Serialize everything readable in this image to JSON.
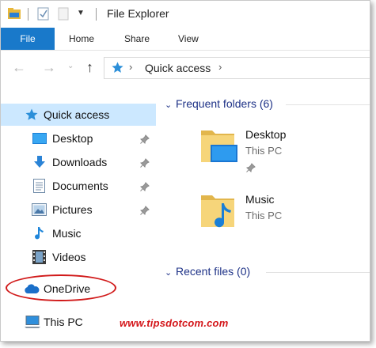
{
  "window": {
    "title": "File Explorer"
  },
  "ribbon": {
    "tabs": [
      "File",
      "Home",
      "Share",
      "View"
    ]
  },
  "address": {
    "location": "Quick access"
  },
  "nav_pane": {
    "items": [
      {
        "label": "Quick access",
        "icon": "star-icon",
        "selected": true
      },
      {
        "label": "Desktop",
        "icon": "desktop-icon",
        "pinned": true
      },
      {
        "label": "Downloads",
        "icon": "download-arrow-icon",
        "pinned": true
      },
      {
        "label": "Documents",
        "icon": "documents-icon",
        "pinned": true
      },
      {
        "label": "Pictures",
        "icon": "pictures-icon",
        "pinned": true
      },
      {
        "label": "Music",
        "icon": "music-note-icon"
      },
      {
        "label": "Videos",
        "icon": "film-icon"
      },
      {
        "label": "OneDrive",
        "icon": "cloud-icon"
      },
      {
        "label": "This PC",
        "icon": "computer-icon"
      }
    ]
  },
  "content": {
    "frequent_header": "Frequent folders (6)",
    "folders": [
      {
        "name": "Desktop",
        "location": "This PC",
        "pinned": true
      },
      {
        "name": "Music",
        "location": "This PC"
      }
    ],
    "recent_header": "Recent files (0)"
  },
  "watermark": "www.tipsdotcom.com",
  "colors": {
    "accent": "#1979ca",
    "selection": "#cce8ff",
    "header_text": "#1e3287",
    "annotation": "#d11a1a"
  }
}
